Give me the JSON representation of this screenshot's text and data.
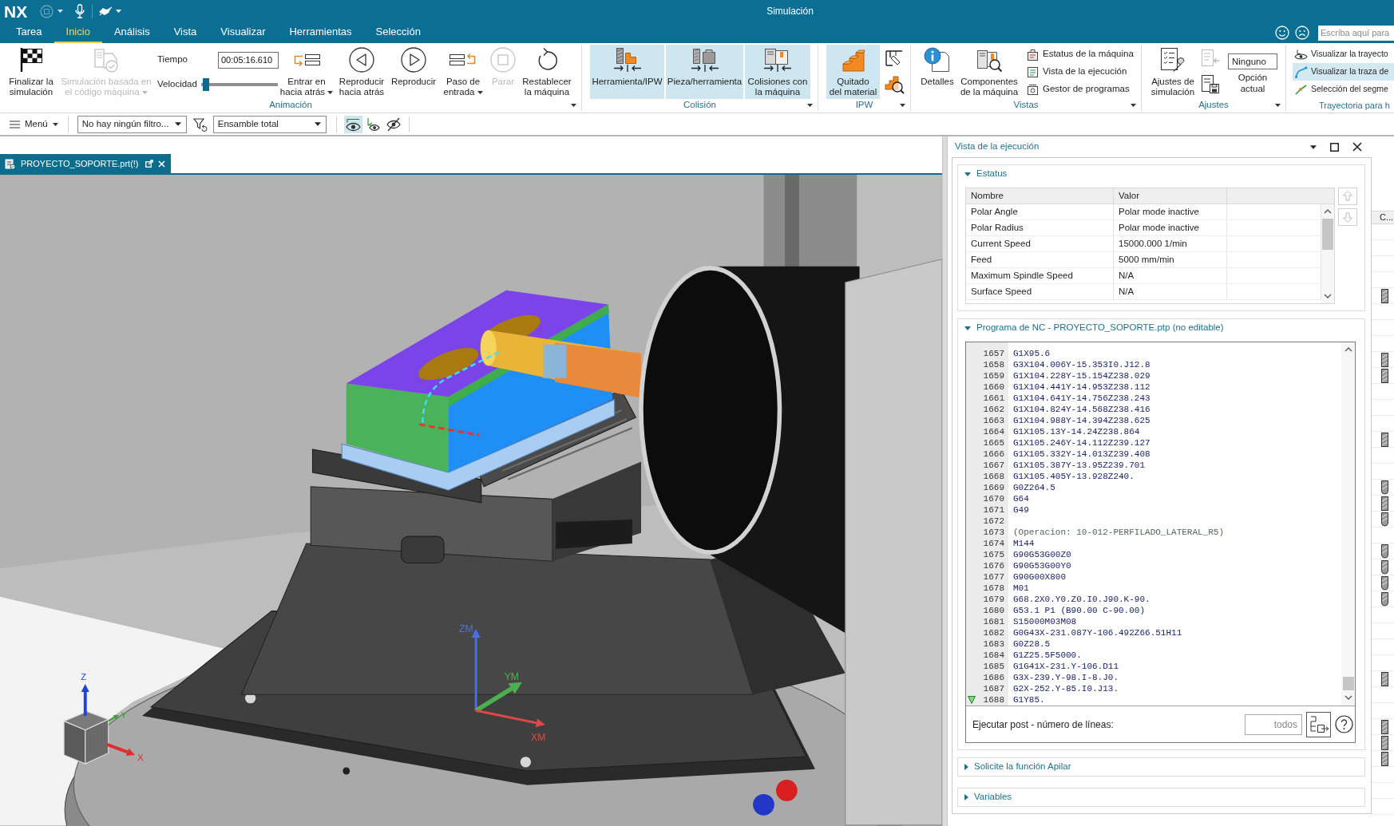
{
  "window": {
    "app": "NX",
    "title": "Simulación",
    "search": {
      "placeholder": "Escriba aquí para"
    }
  },
  "menu_tabs": [
    {
      "label": "Tarea",
      "selected": false
    },
    {
      "label": "Inicio",
      "selected": true
    },
    {
      "label": "Análisis",
      "selected": false
    },
    {
      "label": "Vista",
      "selected": false
    },
    {
      "label": "Visualizar",
      "selected": false
    },
    {
      "label": "Herramientas",
      "selected": false
    },
    {
      "label": "Selección",
      "selected": false
    }
  ],
  "ribbon": {
    "animation": {
      "label": "Animación",
      "finish": {
        "label": "Finalizar la\nsimulación"
      },
      "nc_simulation": {
        "label": "Simulación basada en\nel código máquina",
        "disabled": true,
        "dropdown": true
      },
      "time": {
        "label": "Tiempo",
        "value": "00:05:16.610"
      },
      "speed": {
        "label": "Velocidad",
        "level": 0.02
      },
      "buttons": [
        {
          "label": "Entrar en\nhacia atrás",
          "dropdown": true,
          "disabled": false
        },
        {
          "label": "Reproducir\nhacia atrás",
          "dropdown": false,
          "disabled": false
        },
        {
          "label": "Reproducir",
          "dropdown": false,
          "disabled": false
        },
        {
          "label": "Paso de\nentrada",
          "dropdown": true,
          "disabled": false
        },
        {
          "label": "Parar",
          "dropdown": false,
          "disabled": true
        },
        {
          "label": "Restablecer\nla máquina",
          "dropdown": false,
          "disabled": false
        }
      ]
    },
    "collision": {
      "label": "Colisión",
      "buttons": [
        {
          "label": "Herramienta/IPW",
          "on": true
        },
        {
          "label": "Pieza/herramienta",
          "on": true
        },
        {
          "label": "Colisiones con\nla máquina",
          "on": true
        }
      ]
    },
    "ipw": {
      "label": "IPW",
      "buttons": [
        {
          "label": "Quitado\ndel material",
          "on": true
        }
      ]
    },
    "views": {
      "label": "Vistas",
      "buttons": [
        {
          "label": "Detalles"
        },
        {
          "label": "Componentes\nde la máquina"
        }
      ],
      "links": [
        {
          "label": "Estatus de la máquina"
        },
        {
          "label": "Vista de la ejecución"
        },
        {
          "label": "Gestor de programas"
        }
      ]
    },
    "settings": {
      "label": "Ajustes",
      "button": {
        "label": "Ajustes de\nsimulación"
      },
      "option": {
        "value": "Ninguno",
        "label": "Opción\nactual"
      }
    },
    "toolpath": {
      "label": "Trayectoria para h",
      "links": [
        {
          "label": "Visualizar la trayecto",
          "on": false
        },
        {
          "label": "Visualizar la traza de",
          "on": true
        },
        {
          "label": "Selección del segme",
          "on": false
        }
      ]
    }
  },
  "toolbar": {
    "menu": "Menú",
    "filter": "No hay ningún filtro...",
    "assembly": "Ensamble total",
    "view_toggles": [
      {
        "selected": true
      },
      {
        "selected": false
      },
      {
        "selected": false
      }
    ]
  },
  "document_tab": {
    "label": "PROYECTO_SOPORTE.prt(!)"
  },
  "viewport": {
    "csys_axes": [
      {
        "label": "ZM",
        "color": "#4a6fe0"
      },
      {
        "label": "YM",
        "color": "#4caf50"
      },
      {
        "label": "XM",
        "color": "#e04848"
      }
    ],
    "view_triad": [
      {
        "label": "Z",
        "color": "#1f44d8"
      },
      {
        "label": "Y",
        "color": "#3da53d"
      },
      {
        "label": "X",
        "color": "#e02c2c"
      }
    ]
  },
  "execution_panel": {
    "title": "Vista de la ejecución",
    "status": {
      "title": "Estatus",
      "expanded": true,
      "columns": [
        "Nombre",
        "Valor"
      ],
      "rows": [
        {
          "name": "Polar Angle",
          "value": "Polar mode inactive"
        },
        {
          "name": "Polar Radius",
          "value": "Polar mode inactive"
        },
        {
          "name": "Current Speed",
          "value": "15000.000 1/min"
        },
        {
          "name": "Feed",
          "value": "5000 mm/min"
        },
        {
          "name": "Maximum Spindle Speed",
          "value": "N/A"
        },
        {
          "name": "Surface Speed",
          "value": "N/A"
        }
      ]
    },
    "nc_program": {
      "title": "Programa de NC - PROYECTO_SOPORTE.ptp (no editable)",
      "expanded": true,
      "lines": [
        {
          "number": "1657",
          "code": "G1X95.6",
          "kind": "code",
          "current": false
        },
        {
          "number": "1658",
          "code": "G3X104.006Y-15.353I0.J12.8",
          "kind": "code",
          "current": false
        },
        {
          "number": "1659",
          "code": "G1X104.228Y-15.154Z238.029",
          "kind": "code",
          "current": false
        },
        {
          "number": "1660",
          "code": "G1X104.441Y-14.953Z238.112",
          "kind": "code",
          "current": false
        },
        {
          "number": "1661",
          "code": "G1X104.641Y-14.756Z238.243",
          "kind": "code",
          "current": false
        },
        {
          "number": "1662",
          "code": "G1X104.824Y-14.568Z238.416",
          "kind": "code",
          "current": false
        },
        {
          "number": "1663",
          "code": "G1X104.988Y-14.394Z238.625",
          "kind": "code",
          "current": false
        },
        {
          "number": "1664",
          "code": "G1X105.13Y-14.24Z238.864",
          "kind": "code",
          "current": false
        },
        {
          "number": "1665",
          "code": "G1X105.246Y-14.112Z239.127",
          "kind": "code",
          "current": false
        },
        {
          "number": "1666",
          "code": "G1X105.332Y-14.013Z239.408",
          "kind": "code",
          "current": false
        },
        {
          "number": "1667",
          "code": "G1X105.387Y-13.95Z239.701",
          "kind": "code",
          "current": false
        },
        {
          "number": "1668",
          "code": "G1X105.405Y-13.928Z240.",
          "kind": "code",
          "current": false
        },
        {
          "number": "1669",
          "code": "G0Z264.5",
          "kind": "code",
          "current": false
        },
        {
          "number": "1670",
          "code": "G64",
          "kind": "code",
          "current": false
        },
        {
          "number": "1671",
          "code": "G49",
          "kind": "code",
          "current": false
        },
        {
          "number": "1672",
          "kind": "code",
          "current": false
        },
        {
          "number": "1673",
          "code": "(Operacion: 10-012-PERFILADO_LATERAL_R5)",
          "kind": "comment",
          "current": false
        },
        {
          "number": "1674",
          "code": "M144",
          "kind": "code",
          "current": false
        },
        {
          "number": "1675",
          "code": "G90G53G00Z0",
          "kind": "code",
          "current": false
        },
        {
          "number": "1676",
          "code": "G90G53G00Y0",
          "kind": "code",
          "current": false
        },
        {
          "number": "1677",
          "code": "G90G00X800",
          "kind": "code",
          "current": false
        },
        {
          "number": "1678",
          "code": "M01",
          "kind": "code",
          "current": false
        },
        {
          "number": "1679",
          "code": "G68.2X0.Y0.Z0.I0.J90.K-90.",
          "kind": "code",
          "current": false
        },
        {
          "number": "1680",
          "code": "G53.1 P1 (B90.00 C-90.00)",
          "kind": "code",
          "current": false
        },
        {
          "number": "1681",
          "code": "S15000M03M08",
          "kind": "code",
          "current": false
        },
        {
          "number": "1682",
          "code": "G0G43X-231.087Y-106.492Z66.51H11",
          "kind": "code",
          "current": false
        },
        {
          "number": "1683",
          "code": "G0Z28.5",
          "kind": "code",
          "current": false
        },
        {
          "number": "1684",
          "code": "G1Z25.5F5000.",
          "kind": "code",
          "current": false
        },
        {
          "number": "1685",
          "code": "G1G41X-231.Y-106.D11",
          "kind": "code",
          "current": false
        },
        {
          "number": "1686",
          "code": "G3X-239.Y-98.I-8.J0.",
          "kind": "code",
          "current": false
        },
        {
          "number": "1687",
          "code": "G2X-252.Y-85.I0.J13.",
          "kind": "code",
          "current": false
        },
        {
          "number": "1688",
          "code": "G1Y85.",
          "kind": "code",
          "current": true
        }
      ],
      "post": {
        "label": "Ejecutar post - número de líneas:",
        "placeholder": "todos"
      }
    },
    "sections": [
      {
        "title": "Solicite la función Apilar",
        "expanded": false
      },
      {
        "title": "Variables",
        "expanded": false
      }
    ]
  },
  "side_column": {
    "header": "C...",
    "rows": [
      {
        "kind": "blank"
      },
      {
        "kind": "blank"
      },
      {
        "kind": "blank"
      },
      {
        "kind": "blank"
      },
      {
        "kind": "flat"
      },
      {
        "kind": "blank"
      },
      {
        "kind": "blank"
      },
      {
        "kind": "blank"
      },
      {
        "kind": "flat"
      },
      {
        "kind": "flat"
      },
      {
        "kind": "blank"
      },
      {
        "kind": "blank"
      },
      {
        "kind": "blank"
      },
      {
        "kind": "flat"
      },
      {
        "kind": "blank"
      },
      {
        "kind": "blank"
      },
      {
        "kind": "ball"
      },
      {
        "kind": "flat"
      },
      {
        "kind": "ball"
      },
      {
        "kind": "blank"
      },
      {
        "kind": "ball"
      },
      {
        "kind": "ball"
      },
      {
        "kind": "ball"
      },
      {
        "kind": "ball"
      },
      {
        "kind": "blank"
      },
      {
        "kind": "blank"
      },
      {
        "kind": "blank"
      },
      {
        "kind": "blank"
      },
      {
        "kind": "flat"
      },
      {
        "kind": "blank"
      },
      {
        "kind": "blank"
      },
      {
        "kind": "flat"
      },
      {
        "kind": "flat"
      },
      {
        "kind": "flat"
      },
      {
        "kind": "blank"
      },
      {
        "kind": "blank"
      },
      {
        "kind": "blank"
      }
    ]
  }
}
